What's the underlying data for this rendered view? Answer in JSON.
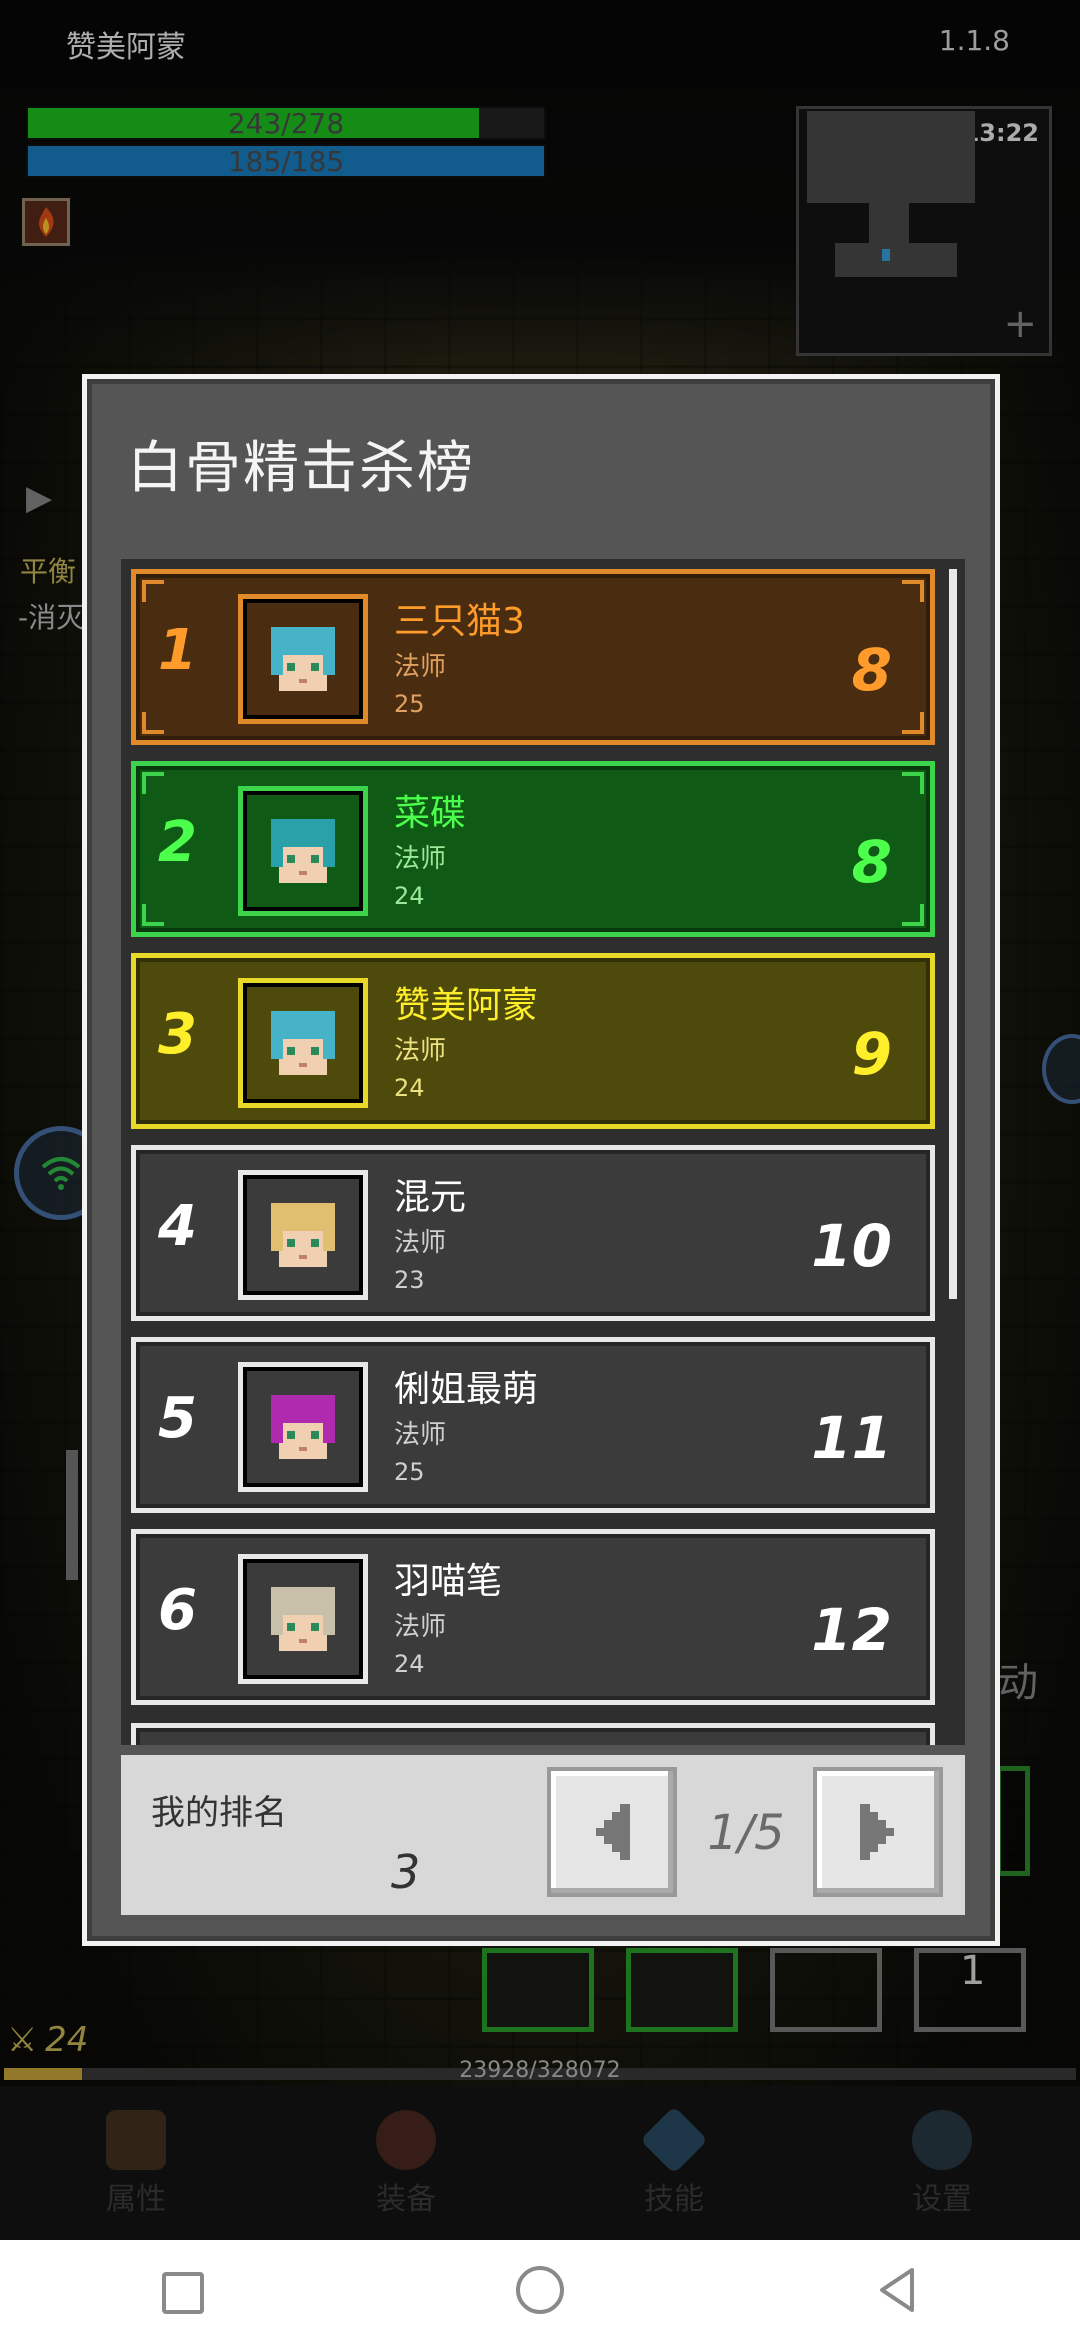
{
  "hud": {
    "player_name": "赞美阿蒙",
    "version": "1.1.8",
    "hp": {
      "current": 243,
      "max": 278,
      "text": "243/278"
    },
    "mp": {
      "current": 185,
      "max": 185,
      "text": "185/185"
    },
    "minimap_time": "13:22",
    "minimap_add": "+",
    "side_text_1": "平衡",
    "side_text_2": "-消灭",
    "side_text_right": "动",
    "slot_count": "1"
  },
  "leaderboard": {
    "title": "白骨精击杀榜",
    "entries": [
      {
        "rank": "1",
        "name": "三只猫3",
        "class": "法师",
        "level": "25",
        "score": "8",
        "theme": "gold",
        "hair": "#46b3c8"
      },
      {
        "rank": "2",
        "name": "菜碟",
        "class": "法师",
        "level": "24",
        "score": "8",
        "theme": "green",
        "hair": "#2aa0a8"
      },
      {
        "rank": "3",
        "name": "赞美阿蒙",
        "class": "法师",
        "level": "24",
        "score": "9",
        "theme": "yellow",
        "hair": "#46b3c8"
      },
      {
        "rank": "4",
        "name": "混元",
        "class": "法师",
        "level": "23",
        "score": "10",
        "theme": "gray",
        "hair": "#e0c070"
      },
      {
        "rank": "5",
        "name": "俐姐最萌",
        "class": "法师",
        "level": "25",
        "score": "11",
        "theme": "gray",
        "hair": "#b02ab0"
      },
      {
        "rank": "6",
        "name": "羽喵笔",
        "class": "法师",
        "level": "24",
        "score": "12",
        "theme": "gray",
        "hair": "#c8c0a8"
      }
    ],
    "my_rank_label": "我的排名",
    "my_rank_value": "3",
    "page": "1/5"
  },
  "experience": {
    "level": "24",
    "current": 23928,
    "max": 328072,
    "text": "23928/328072"
  },
  "tabs": [
    {
      "label": "属性",
      "icon": "helmet-icon",
      "color": "#6a4a2a"
    },
    {
      "label": "装备",
      "icon": "bag-icon",
      "color": "#7a3a2a"
    },
    {
      "label": "技能",
      "icon": "crystal-icon",
      "color": "#3a7aa8"
    },
    {
      "label": "设置",
      "icon": "gear-icon",
      "color": "#3a5a6a"
    }
  ],
  "themes": {
    "gold": {
      "bg": "#4a2d10",
      "border": "#e08a2a",
      "text": "#ff9b2a",
      "sub": "#e0a060"
    },
    "green": {
      "bg": "#0f5a14",
      "border": "#3bd44a",
      "text": "#4cff4c",
      "sub": "#9ae89a"
    },
    "yellow": {
      "bg": "#4e4a0c",
      "border": "#e8d828",
      "text": "#ffee2a",
      "sub": "#ece080"
    },
    "gray": {
      "bg": "#3b3b3b",
      "border": "#e8e8e8",
      "text": "#ffffff",
      "sub": "#d0d0d0"
    }
  }
}
